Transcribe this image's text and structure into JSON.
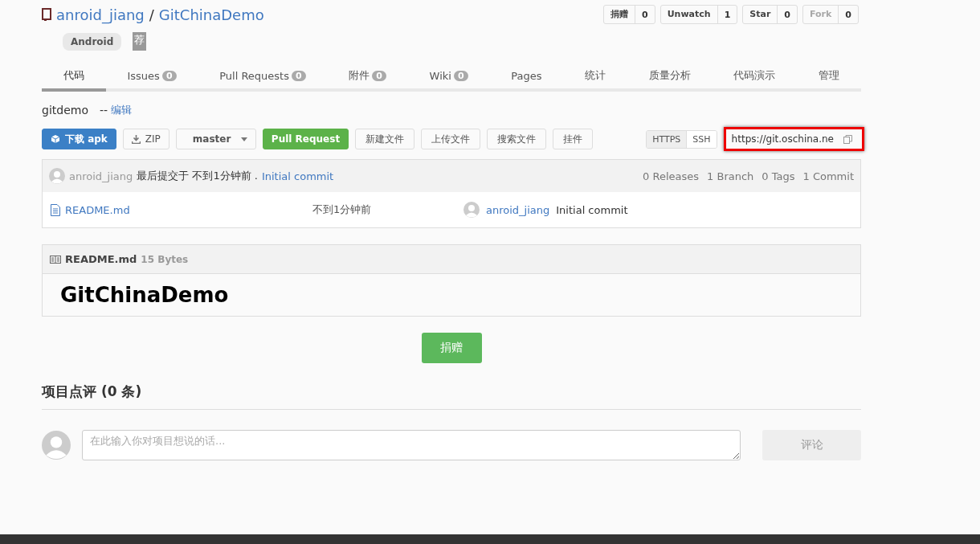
{
  "repo": {
    "owner": "anroid_jiang",
    "separator": "/",
    "name": "GitChinaDemo",
    "tag": "Android",
    "recommend_badge": "荐"
  },
  "actions": [
    {
      "label": "捐赠",
      "count": "0",
      "disabled": false
    },
    {
      "label": "Unwatch",
      "count": "1",
      "disabled": false
    },
    {
      "label": "Star",
      "count": "0",
      "disabled": false
    },
    {
      "label": "Fork",
      "count": "0",
      "disabled": true
    }
  ],
  "tabs": [
    {
      "label": "代码",
      "selected": true
    },
    {
      "label": "Issues",
      "count": "0",
      "selected": false
    },
    {
      "label": "Pull Requests",
      "count": "0",
      "selected": false
    },
    {
      "label": "附件",
      "count": "0",
      "selected": false
    },
    {
      "label": "Wiki",
      "count": "0",
      "selected": false
    },
    {
      "label": "Pages",
      "selected": false
    },
    {
      "label": "统计",
      "selected": false
    },
    {
      "label": "质量分析",
      "selected": false
    },
    {
      "label": "代码演示",
      "selected": false
    },
    {
      "label": "管理",
      "selected": false
    }
  ],
  "description": {
    "text": "gitdemo",
    "separator": "--",
    "edit_link": "编辑"
  },
  "toolbar": [
    {
      "kind": "primary",
      "label": "下载 apk"
    },
    {
      "kind": "download",
      "label": "ZIP"
    },
    {
      "kind": "branch",
      "label": "master"
    },
    {
      "kind": "success",
      "label": "Pull Request"
    },
    {
      "kind": "default",
      "label": "新建文件"
    },
    {
      "kind": "default",
      "label": "上传文件"
    },
    {
      "kind": "default",
      "label": "搜索文件"
    },
    {
      "kind": "default",
      "label": "挂件"
    }
  ],
  "clone": {
    "protocols": [
      {
        "label": "HTTPS",
        "selected": true
      },
      {
        "label": "SSH",
        "selected": false
      }
    ],
    "url": "https://git.oschina.ne",
    "highlighted": true
  },
  "last_commit": {
    "author": "anroid_jiang",
    "text": "最后提交于 不到1分钟前 .",
    "message": "Initial commit",
    "stats": [
      "0 Releases",
      "1 Branch",
      "0 Tags",
      "1 Commit"
    ]
  },
  "files": [
    {
      "name": "README.md",
      "time": "不到1分钟前",
      "author": "anroid_jiang",
      "message": "Initial commit"
    }
  ],
  "readme": {
    "filename": "README.md",
    "size": "15 Bytes",
    "heading": "GitChinaDemo"
  },
  "donate_button": "捐赠",
  "comments": {
    "title": "项目点评 (0 条)",
    "placeholder": "在此输入你对项目想说的话...",
    "submit": "评论",
    "submit_disabled": true
  }
}
